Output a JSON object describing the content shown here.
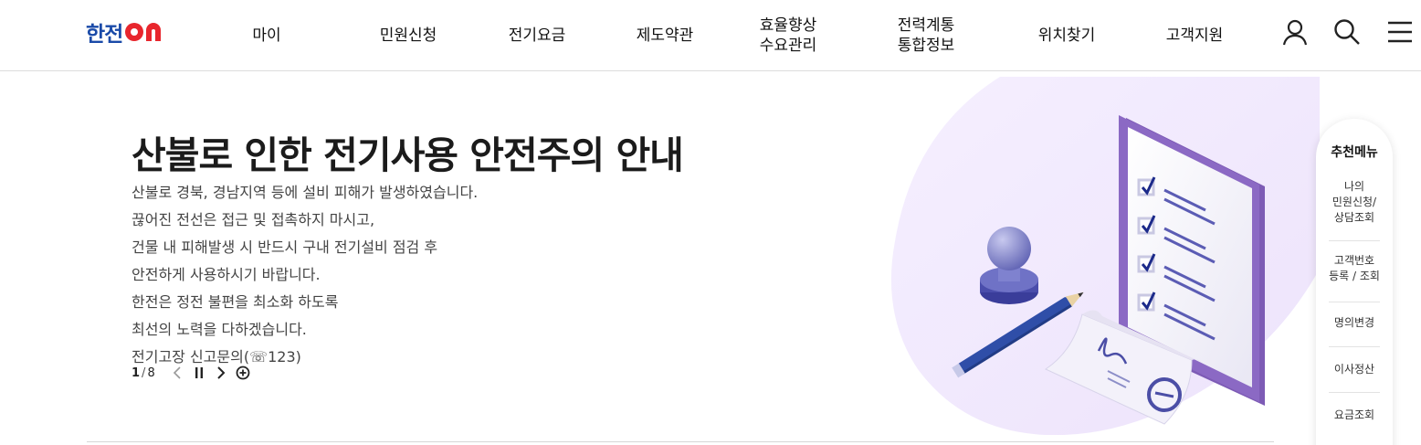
{
  "header": {
    "logo_text": "한전",
    "logo_on": "ON",
    "nav": [
      {
        "label": "마이"
      },
      {
        "label": "민원신청"
      },
      {
        "label": "전기요금"
      },
      {
        "label": "제도약관"
      },
      {
        "label": "효율향상\n수요관리"
      },
      {
        "label": "전력계통\n통합정보"
      },
      {
        "label": "위치찾기"
      },
      {
        "label": "고객지원"
      }
    ],
    "icons": [
      "user-icon",
      "search-icon",
      "menu-icon"
    ]
  },
  "hero": {
    "title": "산불로 인한 전기사용 안전주의 안내",
    "lines": [
      "산불로 경북, 경남지역 등에 설비 피해가 발생하였습니다.",
      "끊어진 전선은 접근 및 접촉하지 마시고,",
      "건물 내 피해발생 시 반드시 구내 전기설비 점검 후",
      "안전하게 사용하시기 바랍니다.",
      "한전은 정전 불편을 최소화 하도록",
      "최선의 노력을 다하겠습니다.",
      "전기고장 신고문의(☏123)"
    ],
    "pager": {
      "current": "1",
      "separator": "/",
      "total": "8"
    }
  },
  "recommend": {
    "title": "추천메뉴",
    "items": [
      {
        "label": "나의\n민원신청/\n상담조회"
      },
      {
        "label": "고객번호\n등록 / 조회"
      },
      {
        "label": "명의변경"
      },
      {
        "label": "이사정산"
      },
      {
        "label": "요금조회"
      }
    ]
  },
  "colors": {
    "brand_blue": "#1a4aa8",
    "brand_red": "#e8262d",
    "illustration_purple": "#7d5bb5"
  }
}
